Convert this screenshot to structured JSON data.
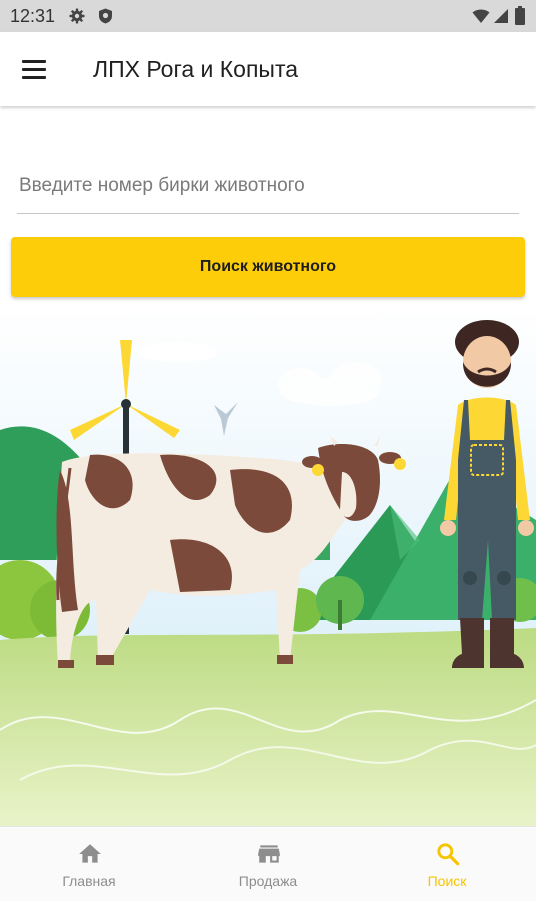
{
  "status_bar": {
    "time": "12:31",
    "icons": [
      "gear-icon",
      "shield-icon",
      "wifi-icon",
      "signal-icon",
      "battery-icon"
    ]
  },
  "app_bar": {
    "menu_icon": "menu-icon",
    "title": "ЛПХ Рога и Копыта"
  },
  "search": {
    "placeholder": "Введите номер бирки животного",
    "value": "",
    "button_label": "Поиск животного"
  },
  "bottom_nav": {
    "items": [
      {
        "label": "Главная",
        "icon": "home-icon",
        "active": false
      },
      {
        "label": "Продажа",
        "icon": "store-icon",
        "active": false
      },
      {
        "label": "Поиск",
        "icon": "search-icon",
        "active": true
      }
    ]
  },
  "colors": {
    "accent": "#fecd0a",
    "active_nav": "#f6c500",
    "inactive_nav": "#8d8d8d"
  }
}
